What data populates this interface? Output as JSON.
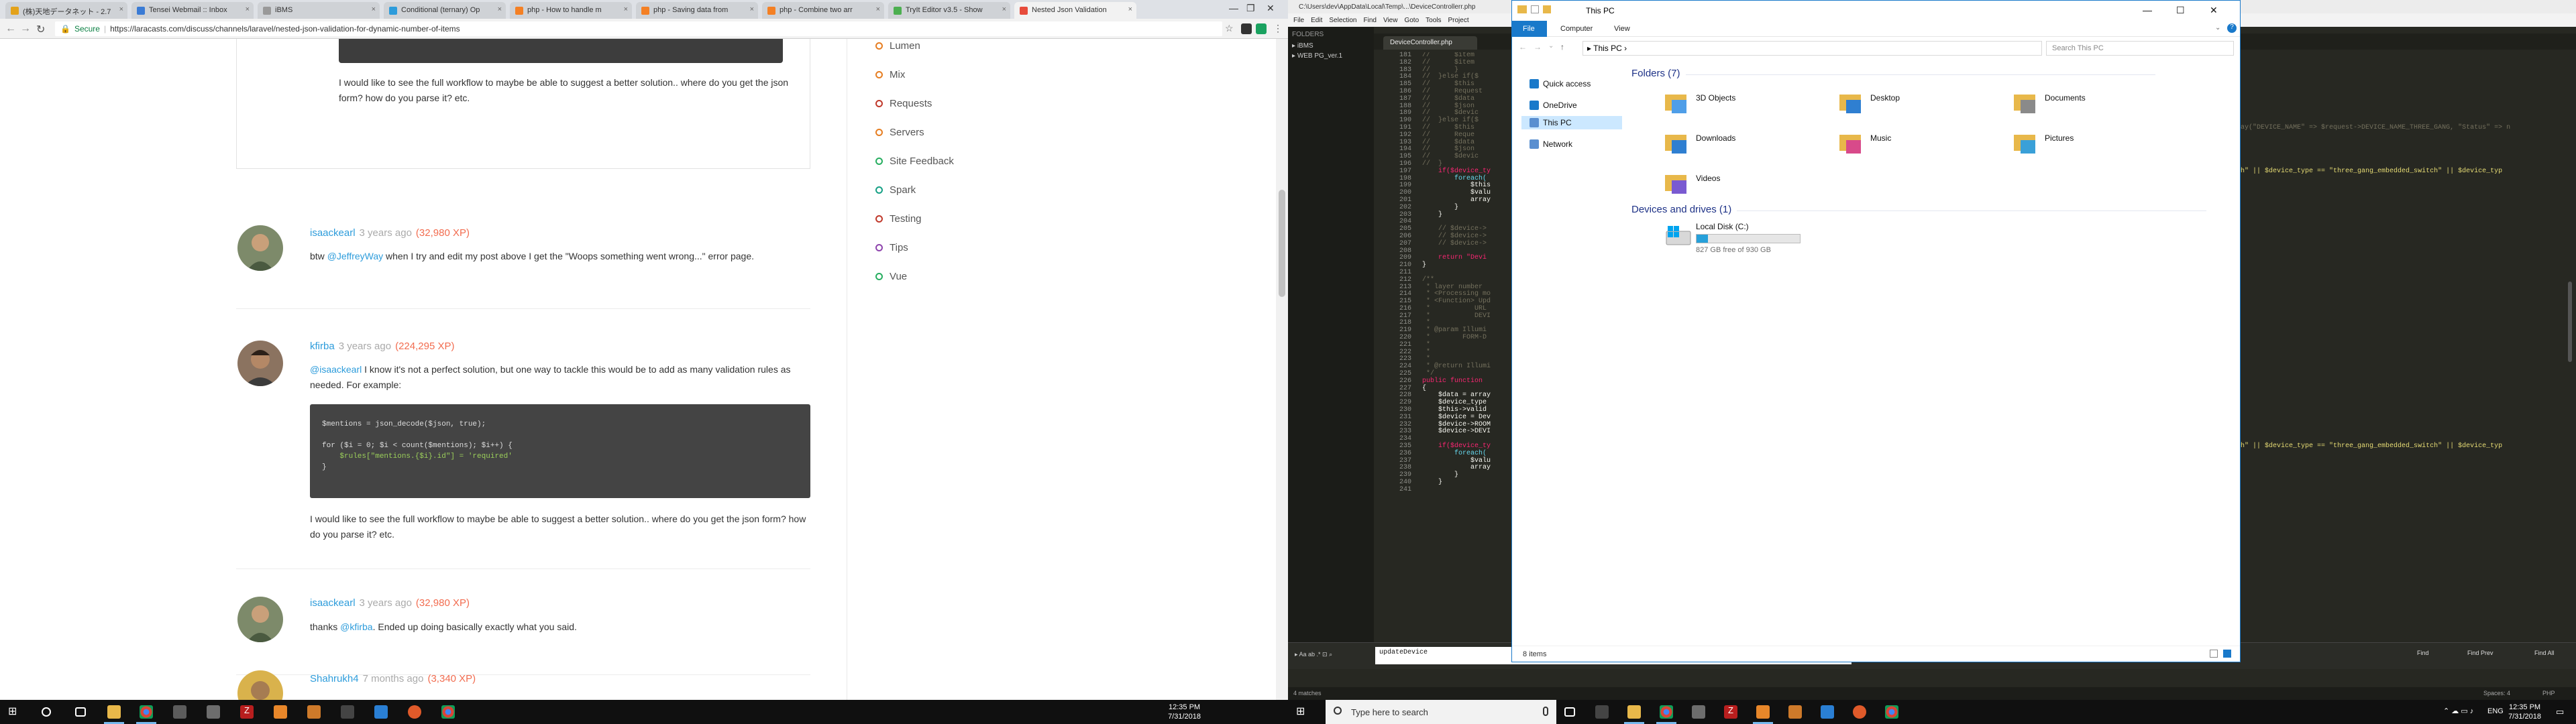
{
  "browser": {
    "tabs": [
      {
        "label": "(株)天地データネット - 2.7",
        "color": "#e3a21a"
      },
      {
        "label": "Tensei Webmail :: Inbox",
        "color": "#3a7bd5"
      },
      {
        "label": "iBMS",
        "color": "#999999"
      },
      {
        "label": "Conditional (ternary) Op",
        "color": "#2d9cdb"
      },
      {
        "label": "php - How to handle m",
        "color": "#f48024"
      },
      {
        "label": "php - Saving data from",
        "color": "#f48024"
      },
      {
        "label": "php - Combine two arr",
        "color": "#f48024"
      },
      {
        "label": "TryIt Editor v3.5 - Show",
        "color": "#4caf50"
      },
      {
        "label": "Nested Json Validation",
        "color": "#e74c3c"
      }
    ],
    "secure_label": "Secure",
    "url": "https://laracasts.com/discuss/channels/laravel/nested-json-validation-for-dynamic-number-of-items"
  },
  "thread": {
    "top_reply_text": "I would like to see the full workflow to maybe be able to suggest a better solution.. where do you get the json form? how do you parse it? etc.",
    "posts": [
      {
        "author": "isaackearl",
        "time": "3 years ago",
        "xp": "(32,980 XP)",
        "body_prefix": "btw ",
        "mention": "@JeffreyWay",
        "body_suffix": " when I try and edit my post above I get the \"Woops something went wrong...\" error page."
      },
      {
        "author": "kfirba",
        "time": "3 years ago",
        "xp": "(224,295 XP)",
        "mention": "@isaackearl",
        "body_suffix": " I know it's not a perfect solution, but one way to tackle this would be to add as many validation rules as needed. For example:",
        "code_line1": "$mentions = json_decode($json, true);",
        "code_line2": "for ($i = 0; $i < count($mentions); $i++) {",
        "code_line3": "    $rules[\"mentions.{$i}.id\"] = 'required'",
        "code_line4": "}",
        "after_code": "I would like to see the full workflow to maybe be able to suggest a better solution.. where do you get the json form? how do you parse it? etc."
      },
      {
        "author": "isaackearl",
        "time": "3 years ago",
        "xp": "(32,980 XP)",
        "body_prefix": "thanks ",
        "mention": "@kfirba",
        "body_suffix": ". Ended up doing basically exactly what you said."
      },
      {
        "author": "Shahrukh4",
        "time": "7 months ago",
        "xp": "(3,340 XP)"
      }
    ]
  },
  "channels": [
    {
      "label": "Lumen",
      "color": "#e67e22"
    },
    {
      "label": "Mix",
      "color": "#e67e22"
    },
    {
      "label": "Requests",
      "color": "#c0392b"
    },
    {
      "label": "Servers",
      "color": "#e67e22"
    },
    {
      "label": "Site Feedback",
      "color": "#27ae60"
    },
    {
      "label": "Spark",
      "color": "#16a085"
    },
    {
      "label": "Testing",
      "color": "#c0392b"
    },
    {
      "label": "Tips",
      "color": "#8e44ad"
    },
    {
      "label": "Vue",
      "color": "#27ae60"
    }
  ],
  "taskbar_left": {
    "time": "12:35 PM",
    "date": "7/31/2018"
  },
  "editor": {
    "title": "C:\\Users\\dev\\AppData\\Local\\Temp\\...\\DeviceControllerr.php",
    "menu": [
      "File",
      "Edit",
      "Selection",
      "Find",
      "View",
      "Goto",
      "Tools",
      "Project"
    ],
    "folders_label": "FOLDERS",
    "folders": [
      "iBMS",
      "WEB PG_ver.1"
    ],
    "active_tab": "DeviceController.php",
    "find_value": "updateDevice",
    "find_buttons": [
      "Find",
      "Find Prev",
      "Find All"
    ],
    "status_left": "4 matches",
    "status_spaces": "Spaces: 4",
    "status_syntax": "PHP"
  },
  "explorer": {
    "title": "This PC",
    "ribbon_file": "File",
    "ribbon_tabs": [
      "Computer",
      "View"
    ],
    "path": "This PC",
    "search_placeholder": "Search This PC",
    "nav": [
      "Quick access",
      "OneDrive",
      "This PC",
      "Network"
    ],
    "folders_group": "Folders (7)",
    "folders": [
      "3D Objects",
      "Desktop",
      "Documents",
      "Downloads",
      "Music",
      "Pictures",
      "Videos"
    ],
    "drives_group": "Devices and drives (1)",
    "drive_name": "Local Disk (C:)",
    "drive_free": "827 GB free of 930 GB",
    "drive_used_fraction": 0.11,
    "status": "8 items"
  },
  "taskbar_right": {
    "search_placeholder": "Type here to search",
    "lang": "ENG",
    "time": "12:35 PM",
    "date": "7/31/2018"
  }
}
